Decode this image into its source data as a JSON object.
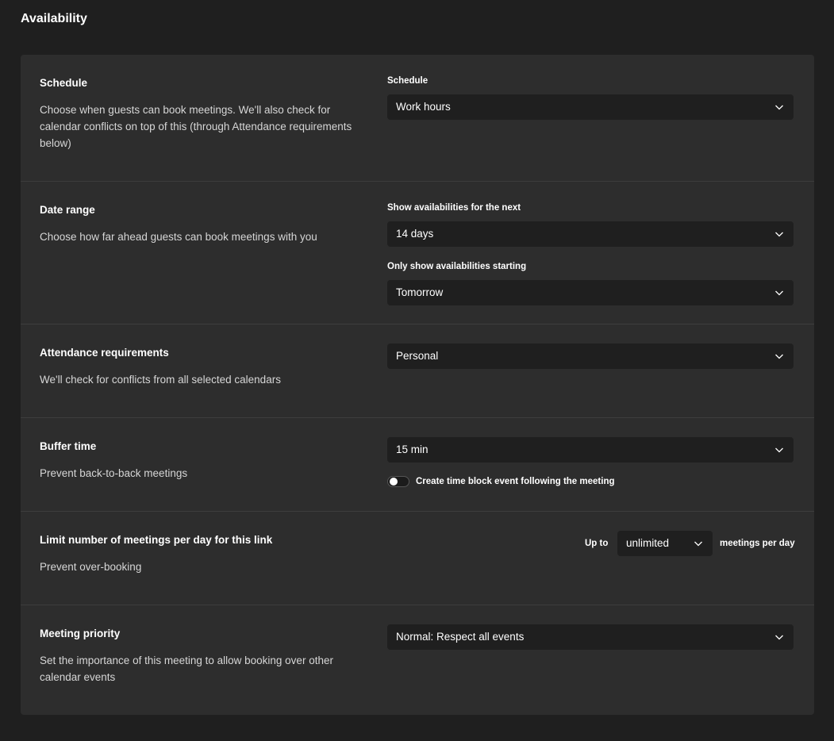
{
  "page": {
    "title": "Availability"
  },
  "sections": {
    "schedule": {
      "title": "Schedule",
      "description": "Choose when guests can book meetings. We'll also check for calendar conflicts on top of this (through Attendance requirements below)",
      "field_label": "Schedule",
      "value": "Work hours"
    },
    "date_range": {
      "title": "Date range",
      "description": "Choose how far ahead guests can book meetings with you",
      "next_label": "Show availabilities for the next",
      "next_value": "14 days",
      "start_label": "Only show availabilities starting",
      "start_value": "Tomorrow"
    },
    "attendance": {
      "title": "Attendance requirements",
      "description": "We'll check for conflicts from all selected calendars",
      "value": "Personal"
    },
    "buffer": {
      "title": "Buffer time",
      "description": "Prevent back-to-back meetings",
      "value": "15 min",
      "toggle_label": "Create time block event following the meeting",
      "toggle_on": false
    },
    "limit": {
      "title": "Limit number of meetings per day for this link",
      "description": "Prevent over-booking",
      "prefix": "Up to",
      "value": "unlimited",
      "suffix": "meetings per day"
    },
    "priority": {
      "title": "Meeting priority",
      "description": "Set the importance of this meeting to allow booking over other calendar events",
      "value": "Normal: Respect all events"
    }
  },
  "icons": {
    "dropdown": "chevron-down-icon"
  },
  "colors": {
    "background": "#1f1f1f",
    "card": "#2d2d2d",
    "divider": "#3d3d3d",
    "text": "#ffffff",
    "muted": "#d6d6d6"
  }
}
